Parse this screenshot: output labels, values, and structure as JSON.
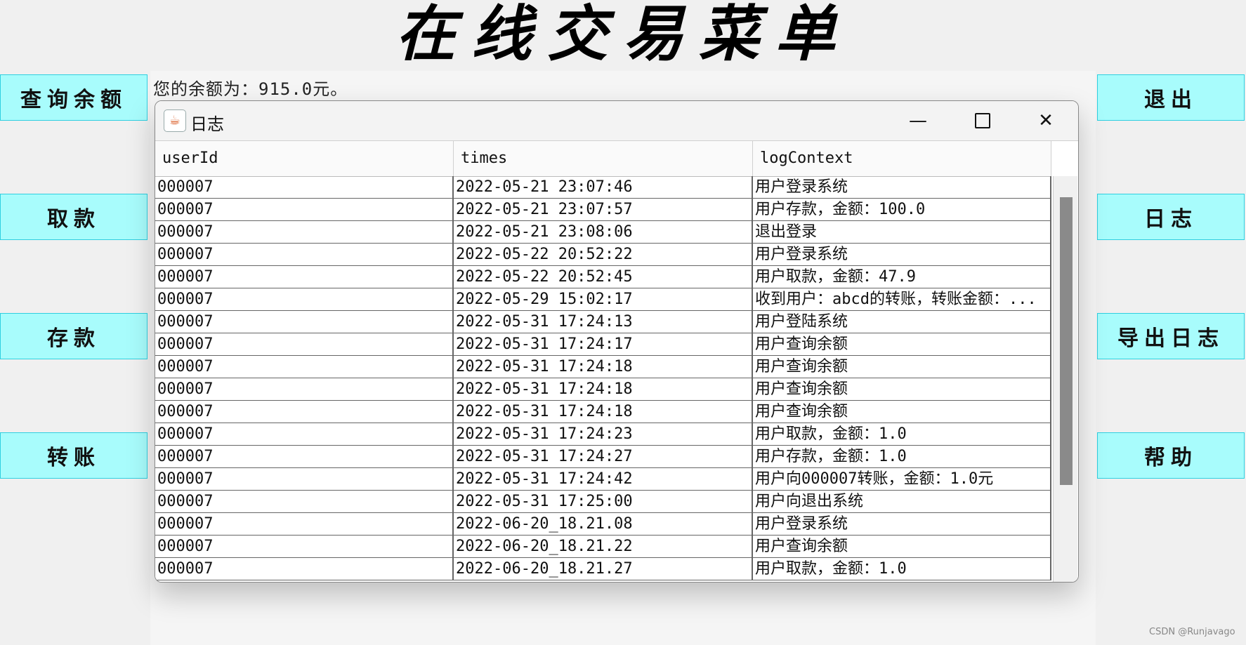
{
  "main_title": "在线交易菜单",
  "balance_text": "您的余额为：915.0元。",
  "left_buttons": [
    "查询余额",
    "取款",
    "存款",
    "转账"
  ],
  "right_buttons": [
    "退出",
    "日志",
    "导出日志",
    "帮助"
  ],
  "log_window": {
    "title": "日志",
    "controls": {
      "minimize": "—",
      "close": "✕"
    },
    "columns": [
      "userId",
      "times",
      "logContext"
    ],
    "rows": [
      [
        "000007",
        "2022-05-21 23:07:46",
        "用户登录系统"
      ],
      [
        "000007",
        "2022-05-21 23:07:57",
        "用户存款，金额：100.0"
      ],
      [
        "000007",
        "2022-05-21 23:08:06",
        "退出登录"
      ],
      [
        "000007",
        "2022-05-22 20:52:22",
        "用户登录系统"
      ],
      [
        "000007",
        "2022-05-22 20:52:45",
        "用户取款，金额：47.9"
      ],
      [
        "000007",
        "2022-05-29 15:02:17",
        "收到用户：abcd的转账，转账金额：..."
      ],
      [
        "000007",
        "2022-05-31 17:24:13",
        "用户登陆系统"
      ],
      [
        "000007",
        "2022-05-31 17:24:17",
        "用户查询余额"
      ],
      [
        "000007",
        "2022-05-31 17:24:18",
        "用户查询余额"
      ],
      [
        "000007",
        "2022-05-31 17:24:18",
        "用户查询余额"
      ],
      [
        "000007",
        "2022-05-31 17:24:18",
        "用户查询余额"
      ],
      [
        "000007",
        "2022-05-31 17:24:23",
        "用户取款，金额：1.0"
      ],
      [
        "000007",
        "2022-05-31 17:24:27",
        "用户存款，金额：1.0"
      ],
      [
        "000007",
        "2022-05-31 17:24:42",
        "用户向000007转账，金额：1.0元"
      ],
      [
        "000007",
        "2022-05-31 17:25:00",
        "用户向退出系统"
      ],
      [
        "000007",
        "2022-06-20_18.21.08",
        "用户登录系统"
      ],
      [
        "000007",
        "2022-06-20_18.21.22",
        "用户查询余额"
      ],
      [
        "000007",
        "2022-06-20_18.21.27",
        "用户取款，金额：1.0"
      ]
    ]
  },
  "watermark": "CSDN @Runjavago",
  "colors": {
    "button_bg": "#a8fcfc",
    "button_border": "#2fcfe0",
    "page_bg": "#f0f0f0"
  },
  "icons": {
    "app_icon": "java-cup-icon"
  }
}
